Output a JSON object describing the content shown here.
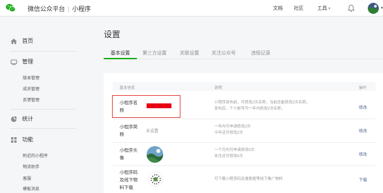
{
  "topbar": {
    "brand": "微信公众平台",
    "section": "小程序",
    "links": [
      "文档",
      "社区",
      "工具"
    ],
    "tools_arrow": "▾",
    "icons": [
      "wechat-logo-icon",
      "bell-icon",
      "user-avatar"
    ],
    "brand_color": "#1aad19"
  },
  "sidebar": {
    "home": "首页",
    "manage": "管理",
    "manage_items": [
      "版本管理",
      "成员管理",
      "反馈管理"
    ],
    "stats": "统计",
    "features": "功能",
    "feature_items": [
      "附近的小程序",
      "物流助手",
      "客服",
      "模板消息"
    ]
  },
  "main": {
    "title": "设置",
    "tabs": [
      "基本设置",
      "第三方设置",
      "关联设置",
      "关注公众号",
      "违规记录"
    ],
    "active_tab": "基本设置",
    "table": {
      "headers": [
        "基本信息",
        "说明",
        "操作"
      ],
      "rows": [
        {
          "label": "小程序名称",
          "value": "",
          "desc": [
            "小程序发布前，可修改2次名称。当前还能修改2次名称。",
            "发布后，个人帐号可一年内修改2次名称。"
          ],
          "op": "修改"
        },
        {
          "label": "小程序简称",
          "value": "未设置",
          "desc": [
            "一年内可申请修改2次",
            "今年还可修改2次"
          ],
          "op": "修改"
        },
        {
          "label": "小程序头像",
          "value": "",
          "desc": [
            "一个月内可申请修改5次",
            "本月还可修改5次"
          ],
          "op": "修改"
        },
        {
          "label": "小程序码及线下物料下载",
          "value": "",
          "desc": [
            "可下载小程序码及搜索框等线下推广物料"
          ],
          "op": "下载"
        }
      ]
    },
    "highlight_color": "#e64340",
    "redaction_color": "#e60012",
    "link_color": "#576b95"
  }
}
